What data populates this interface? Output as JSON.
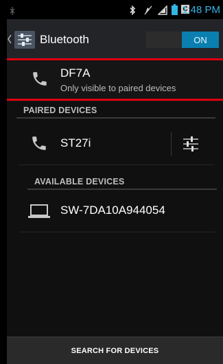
{
  "status_bar": {
    "time": "1:48 PM",
    "battery_letter": "C"
  },
  "action_bar": {
    "title": "Bluetooth",
    "toggle_label": "ON",
    "toggle_state": "on",
    "accent_color": "#33b5e5"
  },
  "this_device": {
    "name": "DF7A",
    "subtitle": "Only visible to paired devices",
    "icon": "phone-icon"
  },
  "paired_section": {
    "header": "PAIRED DEVICES",
    "devices": [
      {
        "name": "ST27i",
        "icon": "phone-icon",
        "has_settings": true
      }
    ]
  },
  "available_section": {
    "header": "AVAILABLE DEVICES",
    "devices": [
      {
        "name": "SW-7DA10A944054",
        "icon": "laptop-icon"
      }
    ]
  },
  "bottom_action": {
    "label": "SEARCH FOR DEVICES"
  }
}
